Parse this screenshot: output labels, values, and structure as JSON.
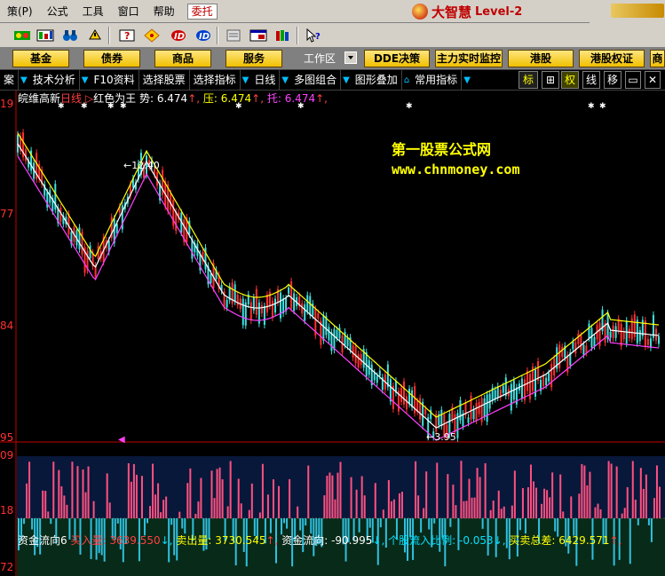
{
  "menu": {
    "items": [
      "策(P)",
      "公式",
      "工具",
      "窗口",
      "帮助"
    ],
    "entrust": "委托",
    "brand": {
      "name": "大智慧",
      "level": "Level-2"
    }
  },
  "funcbar": {
    "buttons": [
      "基金",
      "债券",
      "商品",
      "服务"
    ],
    "workzone": "工作区",
    "right_buttons": [
      "DDE决策",
      "主力实时监控",
      "港股",
      "港股权证",
      "商"
    ]
  },
  "subbar": {
    "items": [
      "案",
      "技术分析",
      "F10资料",
      "选择股票",
      "选择指标",
      "日线",
      "多图组合",
      "图形叠加",
      "常用指标"
    ],
    "boxes": [
      "标",
      "权",
      "线",
      "移"
    ]
  },
  "price_panel": {
    "stock": "皖维高新",
    "period": "日线",
    "indicator": "红色为王",
    "legend": [
      {
        "label": "势",
        "value": "6.474",
        "color": "#ffffff"
      },
      {
        "label": "压",
        "value": "6.474",
        "color": "#ffff00"
      },
      {
        "label": "托",
        "value": "6.474",
        "color": "#ff40ff"
      }
    ],
    "high_label": "12.40",
    "low_label": "3.95",
    "watermark_title": "第一股票公式网",
    "watermark_url": "www.chnmoney.com",
    "axis_labels": [
      "19",
      "77",
      "84",
      "95"
    ]
  },
  "flow_panel": {
    "title": "资金流向6",
    "legend": [
      {
        "label": "买入量",
        "value": "3639.550",
        "color": "#ff4040"
      },
      {
        "label": "卖出量",
        "value": "3730.545",
        "color": "#ffff00"
      },
      {
        "label": "资金流向",
        "value": "-90.995",
        "color": "#ffffff"
      },
      {
        "label": "个股流入比例",
        "value": "-0.053",
        "color": "#00e0ff"
      },
      {
        "label": "买卖总差",
        "value": "6429.571",
        "color": "#ffff00"
      }
    ],
    "axis_labels": [
      "09",
      "18",
      "72"
    ]
  },
  "colors": {
    "up": "#ff3030",
    "down": "#40e0e0",
    "pressure": "#ffff00",
    "support": "#ff40ff",
    "trend": "#ffffff"
  }
}
